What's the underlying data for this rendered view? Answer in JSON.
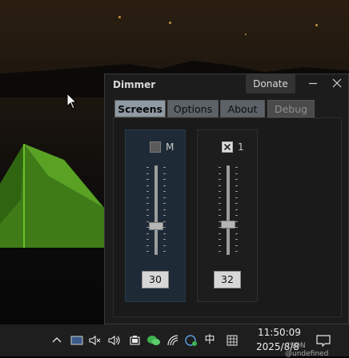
{
  "window": {
    "title": "Dimmer",
    "donate_label": "Donate",
    "minimize_icon": "minimize-icon",
    "close_icon": "close-icon"
  },
  "tabs": [
    {
      "label": "Screens",
      "state": "active"
    },
    {
      "label": "Options",
      "state": "normal"
    },
    {
      "label": "About",
      "state": "normal"
    },
    {
      "label": "Debug",
      "state": "disabled"
    }
  ],
  "screens": [
    {
      "checkbox_label": "M",
      "checked": false,
      "selected": true,
      "value": "30",
      "level_percent": 30
    },
    {
      "checkbox_label": "1",
      "checked": true,
      "selected": false,
      "value": "32",
      "level_percent": 32
    }
  ],
  "taskbar": {
    "tray_icons": [
      "chevron-up-icon",
      "display-icon",
      "speaker-icon",
      "volume-icon",
      "battery-icon",
      "wechat-icon",
      "wifi-icon",
      "network-globe-icon",
      "ime-chinese-icon",
      "ime-grid-icon"
    ],
    "ime_label": "中",
    "time": "11:50:09",
    "date": "2025/8/8",
    "watermark": "CSDN @undefined",
    "notification_icon": "notification-icon"
  },
  "colors": {
    "tab_active": "#8f9aa3",
    "tab_normal": "#5c6268",
    "screen_selected": "#1e2b37",
    "window_bg": "#1c1c1c",
    "tent_green": "#4d8d1e"
  }
}
